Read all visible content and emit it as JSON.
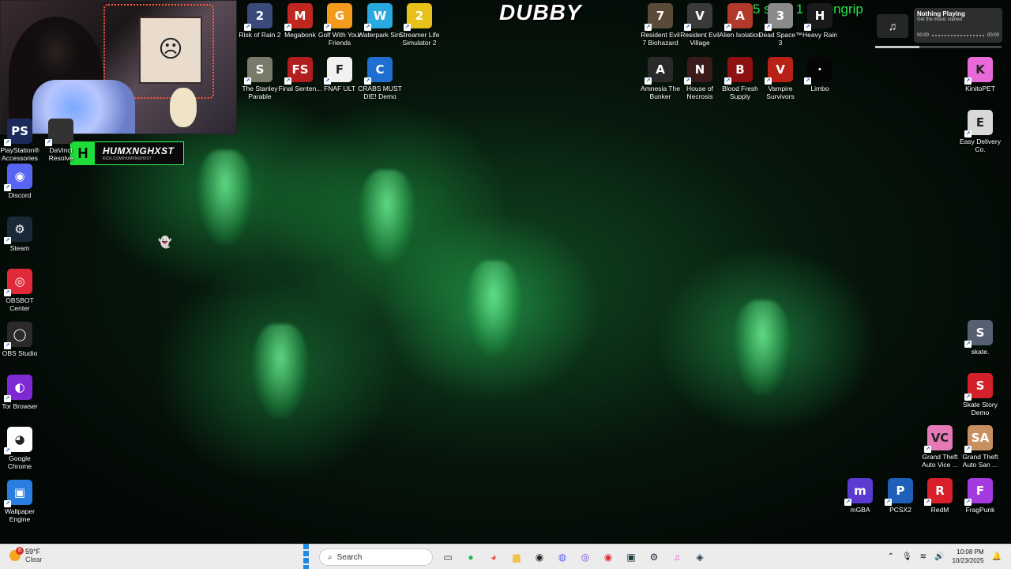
{
  "overlay": {
    "dubby_logo": "DUBBY",
    "sub_goal": "5 subs 1 g bongrip",
    "streamer_tag": {
      "name": "HUMXNGHXST",
      "url": "KICK.COM/HUMXNGHXST",
      "letter": "H"
    }
  },
  "now_playing": {
    "title": "Nothing Playing",
    "subtitle": "Get the music started",
    "time_start": "00:00",
    "time_end": "00:00",
    "progress": 0.35
  },
  "desktop_icons_left": [
    {
      "label": "PlayStation® Accessories",
      "icon": "playstation-icon",
      "color": "#1b2a5a"
    },
    {
      "label": "DaVinci Resolve",
      "icon": "davinci-icon",
      "color": "#333"
    },
    {
      "label": "Discord",
      "icon": "discord-icon",
      "color": "#5865f2"
    },
    {
      "label": "Steam",
      "icon": "steam-icon",
      "color": "#1b2838"
    },
    {
      "label": "OBSBOT Center",
      "icon": "obsbot-icon",
      "color": "#e02a3a"
    },
    {
      "label": "OBS Studio",
      "icon": "obs-icon",
      "color": "#2a2a2a"
    },
    {
      "label": "Tor Browser",
      "icon": "tor-icon",
      "color": "#7d2ad4"
    },
    {
      "label": "Google Chrome",
      "icon": "chrome-icon",
      "color": "#ffffff"
    },
    {
      "label": "Wallpaper Engine",
      "icon": "wallpaper-engine-icon",
      "color": "#2a7de1"
    }
  ],
  "desktop_icons_top": [
    {
      "label": "Risk of Rain 2",
      "glyph": "2",
      "color": "#3b4a7a"
    },
    {
      "label": "Megabonk",
      "glyph": "M",
      "color": "#c0271f"
    },
    {
      "label": "Golf With Your Friends",
      "glyph": "G",
      "color": "#f29b1d"
    },
    {
      "label": "Waterpark Sim",
      "glyph": "W",
      "color": "#2aa8e0"
    },
    {
      "label": "Streamer Life Simulator 2",
      "glyph": "2",
      "color": "#e8c21a"
    },
    {
      "label": "The Stanley Parable",
      "glyph": "S",
      "color": "#7a7a6a"
    },
    {
      "label": "Final Senten...",
      "glyph": "FS",
      "color": "#b21e1e"
    },
    {
      "label": "FNAF ULT",
      "glyph": "F",
      "color": "#f1f1f1"
    },
    {
      "label": "CRABS MUST DIE! Demo",
      "glyph": "C",
      "color": "#1f6fd0"
    },
    {
      "label": "Resident Evil 7 Biohazard",
      "glyph": "7",
      "color": "#5a4a38"
    },
    {
      "label": "Resident Evil Village",
      "glyph": "V",
      "color": "#3a3a3a"
    },
    {
      "label": "Alien Isolation",
      "glyph": "A",
      "color": "#b33a2a"
    },
    {
      "label": "Dead Space™ 3",
      "glyph": "3",
      "color": "#8a8a8a"
    },
    {
      "label": "Heavy Rain",
      "glyph": "H",
      "color": "#1a1a1a"
    },
    {
      "label": "Amnesia The Bunker",
      "glyph": "A",
      "color": "#2a2a2a"
    },
    {
      "label": "House of Necrosis",
      "glyph": "N",
      "color": "#3a1a1a"
    },
    {
      "label": "Blood Fresh Supply",
      "glyph": "B",
      "color": "#8e1010"
    },
    {
      "label": "Vampire Survivors",
      "glyph": "V",
      "color": "#b82216"
    },
    {
      "label": "Limbo",
      "glyph": "·",
      "color": "#050505"
    }
  ],
  "desktop_icons_right": [
    {
      "label": "KinitoPET",
      "glyph": "K",
      "color": "#e86ad8"
    },
    {
      "label": "Easy Delivery Co.",
      "glyph": "E",
      "color": "#d8d8d8"
    },
    {
      "label": "skate.",
      "glyph": "S",
      "color": "#556070"
    },
    {
      "label": "Skate Story Demo",
      "glyph": "S",
      "color": "#d4202a"
    },
    {
      "label": "Grand Theft Auto Vice ...",
      "glyph": "VC",
      "color": "#e67ab6"
    },
    {
      "label": "Grand Theft Auto San ...",
      "glyph": "SA",
      "color": "#c89060"
    },
    {
      "label": "mGBA",
      "glyph": "m",
      "color": "#5a3ad0"
    },
    {
      "label": "PCSX2",
      "glyph": "P",
      "color": "#1e5fb8"
    },
    {
      "label": "RedM",
      "glyph": "R",
      "color": "#d8202a"
    },
    {
      "label": "FragPunk",
      "glyph": "F",
      "color": "#a53ae0"
    }
  ],
  "taskbar": {
    "weather_temp": "59°F",
    "weather_cond": "Clear",
    "weather_badge": "8",
    "search_placeholder": "Search",
    "apps": [
      "task-view-icon",
      "spotify-icon",
      "chrome-icon",
      "file-explorer-icon",
      "obs-icon",
      "discord-icon",
      "browser-icon",
      "obsbot-icon",
      "terminal-icon",
      "steam-icon",
      "itunes-icon",
      "davinci-icon"
    ],
    "time": "10:08 PM",
    "date": "10/23/2025"
  }
}
